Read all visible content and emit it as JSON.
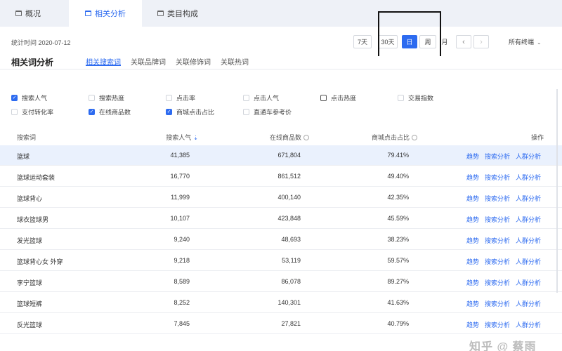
{
  "tabs": [
    {
      "label": "概况",
      "active": false
    },
    {
      "label": "相关分析",
      "active": true
    },
    {
      "label": "类目构成",
      "active": false
    }
  ],
  "toolbar": {
    "stat_date": "统计时间 2020-07-12",
    "ranges": [
      "7天",
      "30天",
      "日",
      "周",
      "月"
    ],
    "active_range": "日",
    "prev_icon": "chevron-left-icon",
    "next_icon": "chevron-right-icon",
    "store_select": "所有终端"
  },
  "panel": {
    "title": "相关词分析",
    "subtabs": [
      "相关搜索词",
      "关联品牌词",
      "关联修饰词",
      "关联热词"
    ],
    "active_subtab": "相关搜索词"
  },
  "metrics": [
    {
      "label": "搜索人气",
      "checked": true
    },
    {
      "label": "搜索热度",
      "checked": false
    },
    {
      "label": "点击率",
      "checked": false
    },
    {
      "label": "点击人气",
      "checked": false
    },
    {
      "label": "点击热度",
      "checked": false,
      "outlined": true
    },
    {
      "label": "交易指数",
      "checked": false
    },
    {
      "label": "支付转化率",
      "checked": false
    },
    {
      "label": "在线商品数",
      "checked": true
    },
    {
      "label": "商城点击占比",
      "checked": true
    },
    {
      "label": "直通车参考价",
      "checked": false
    }
  ],
  "table": {
    "columns": [
      "搜索词",
      "搜索人气",
      "在线商品数",
      "商城点击占比",
      "操作"
    ],
    "actions": [
      "趋势",
      "搜索分析",
      "人群分析"
    ],
    "rows": [
      {
        "keyword": "篮球",
        "search_popularity": "41,385",
        "online_products": "671,804",
        "mall_click_ratio": "79.41%"
      },
      {
        "keyword": "篮球运动套装",
        "search_popularity": "16,770",
        "online_products": "861,512",
        "mall_click_ratio": "49.40%"
      },
      {
        "keyword": "篮球背心",
        "search_popularity": "11,999",
        "online_products": "400,140",
        "mall_click_ratio": "42.35%"
      },
      {
        "keyword": "球衣篮球男",
        "search_popularity": "10,107",
        "online_products": "423,848",
        "mall_click_ratio": "45.59%"
      },
      {
        "keyword": "发光篮球",
        "search_popularity": "9,240",
        "online_products": "48,693",
        "mall_click_ratio": "38.23%"
      },
      {
        "keyword": "篮球背心女 外穿",
        "search_popularity": "9,218",
        "online_products": "53,119",
        "mall_click_ratio": "59.57%"
      },
      {
        "keyword": "李宁篮球",
        "search_popularity": "8,589",
        "online_products": "86,078",
        "mall_click_ratio": "89.27%"
      },
      {
        "keyword": "篮球短裤",
        "search_popularity": "8,252",
        "online_products": "140,301",
        "mall_click_ratio": "41.63%"
      },
      {
        "keyword": "反光篮球",
        "search_popularity": "7,845",
        "online_products": "27,821",
        "mall_click_ratio": "40.79%"
      }
    ]
  },
  "watermark": "知乎 @ 蔡雨",
  "colors": {
    "accent": "#2d6bf0",
    "selected_row": "#eaf1fd"
  }
}
